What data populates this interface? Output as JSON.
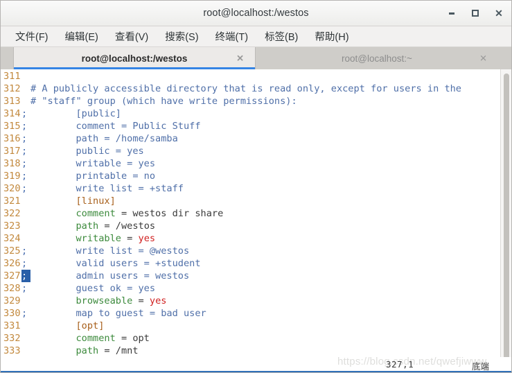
{
  "window": {
    "title": "root@localhost:/westos",
    "buttons": {
      "minimize": "minimize-icon",
      "maximize": "maximize-icon",
      "close": "✕"
    }
  },
  "menubar": {
    "items": [
      {
        "label": "文件(F)"
      },
      {
        "label": "编辑(E)"
      },
      {
        "label": "查看(V)"
      },
      {
        "label": "搜索(S)"
      },
      {
        "label": "终端(T)"
      },
      {
        "label": "标签(B)"
      },
      {
        "label": "帮助(H)"
      }
    ]
  },
  "tabs": [
    {
      "label": "root@localhost:/westos",
      "close": "✕",
      "active": true
    },
    {
      "label": "root@localhost:~",
      "close": "✕",
      "active": false
    }
  ],
  "editor": {
    "lines": [
      {
        "num": "311",
        "mark": "",
        "cursor": false,
        "segments": []
      },
      {
        "num": "312",
        "mark": "",
        "cursor": false,
        "segments": [
          {
            "text": "# A publicly accessible directory that is read only, except for users in the",
            "cls": "c-comment"
          }
        ]
      },
      {
        "num": "313",
        "mark": "",
        "cursor": false,
        "segments": [
          {
            "text": "# \"staff\" group (which have write permissions):",
            "cls": "c-comment"
          }
        ]
      },
      {
        "num": "314",
        "mark": ";",
        "cursor": false,
        "segments": [
          {
            "text": "        [public]",
            "cls": "c-comment"
          }
        ]
      },
      {
        "num": "315",
        "mark": ";",
        "cursor": false,
        "segments": [
          {
            "text": "        comment = Public Stuff",
            "cls": "c-comment"
          }
        ]
      },
      {
        "num": "316",
        "mark": ";",
        "cursor": false,
        "segments": [
          {
            "text": "        path = /home/samba",
            "cls": "c-comment"
          }
        ]
      },
      {
        "num": "317",
        "mark": ";",
        "cursor": false,
        "segments": [
          {
            "text": "        public = yes",
            "cls": "c-comment"
          }
        ]
      },
      {
        "num": "318",
        "mark": ";",
        "cursor": false,
        "segments": [
          {
            "text": "        writable = yes",
            "cls": "c-comment"
          }
        ]
      },
      {
        "num": "319",
        "mark": ";",
        "cursor": false,
        "segments": [
          {
            "text": "        printable = no",
            "cls": "c-comment"
          }
        ]
      },
      {
        "num": "320",
        "mark": ";",
        "cursor": false,
        "segments": [
          {
            "text": "        write list = +staff",
            "cls": "c-comment"
          }
        ]
      },
      {
        "num": "321",
        "mark": "",
        "cursor": false,
        "segments": [
          {
            "text": "        [linux]",
            "cls": "c-section"
          }
        ]
      },
      {
        "num": "322",
        "mark": "",
        "cursor": false,
        "segments": [
          {
            "text": "        comment",
            "cls": "c-key"
          },
          {
            "text": " = westos dir share",
            "cls": "c-plain"
          }
        ]
      },
      {
        "num": "323",
        "mark": "",
        "cursor": false,
        "segments": [
          {
            "text": "        path",
            "cls": "c-key"
          },
          {
            "text": " = /westos",
            "cls": "c-plain"
          }
        ]
      },
      {
        "num": "324",
        "mark": "",
        "cursor": false,
        "segments": [
          {
            "text": "        writable",
            "cls": "c-key"
          },
          {
            "text": " = ",
            "cls": "c-plain"
          },
          {
            "text": "yes",
            "cls": "c-val-red"
          }
        ]
      },
      {
        "num": "325",
        "mark": ";",
        "cursor": false,
        "segments": [
          {
            "text": "        write list = @westos",
            "cls": "c-comment"
          }
        ]
      },
      {
        "num": "326",
        "mark": ";",
        "cursor": false,
        "segments": [
          {
            "text": "        valid users = +student",
            "cls": "c-comment"
          }
        ]
      },
      {
        "num": "327",
        "mark": ";",
        "cursor": true,
        "segments": [
          {
            "text": "        admin users = westos",
            "cls": "c-comment"
          }
        ]
      },
      {
        "num": "328",
        "mark": ";",
        "cursor": false,
        "segments": [
          {
            "text": "        guest ok = yes",
            "cls": "c-comment"
          }
        ]
      },
      {
        "num": "329",
        "mark": "",
        "cursor": false,
        "segments": [
          {
            "text": "        browseable",
            "cls": "c-key"
          },
          {
            "text": " = ",
            "cls": "c-plain"
          },
          {
            "text": "yes",
            "cls": "c-val-red"
          }
        ]
      },
      {
        "num": "330",
        "mark": ";",
        "cursor": false,
        "segments": [
          {
            "text": "        map to guest = bad user",
            "cls": "c-comment"
          }
        ]
      },
      {
        "num": "331",
        "mark": "",
        "cursor": false,
        "segments": [
          {
            "text": "        [opt]",
            "cls": "c-section"
          }
        ]
      },
      {
        "num": "332",
        "mark": "",
        "cursor": false,
        "segments": [
          {
            "text": "        comment",
            "cls": "c-key"
          },
          {
            "text": " = opt",
            "cls": "c-plain"
          }
        ]
      },
      {
        "num": "333",
        "mark": "",
        "cursor": false,
        "segments": [
          {
            "text": "        path",
            "cls": "c-key"
          },
          {
            "text": " = /mnt",
            "cls": "c-plain"
          }
        ]
      }
    ]
  },
  "statusbar": {
    "position": "327,1",
    "state": "底端",
    "watermark": "https://blog.csdn.net/qwefjiwww"
  },
  "colors": {
    "accent": "#3584e4",
    "line_number": "#c2883c",
    "comment": "#4f6fa8",
    "section": "#a8601c",
    "key": "#3c8a3c",
    "value_red": "#d02020",
    "cursor_bg": "#2a5fa8"
  }
}
